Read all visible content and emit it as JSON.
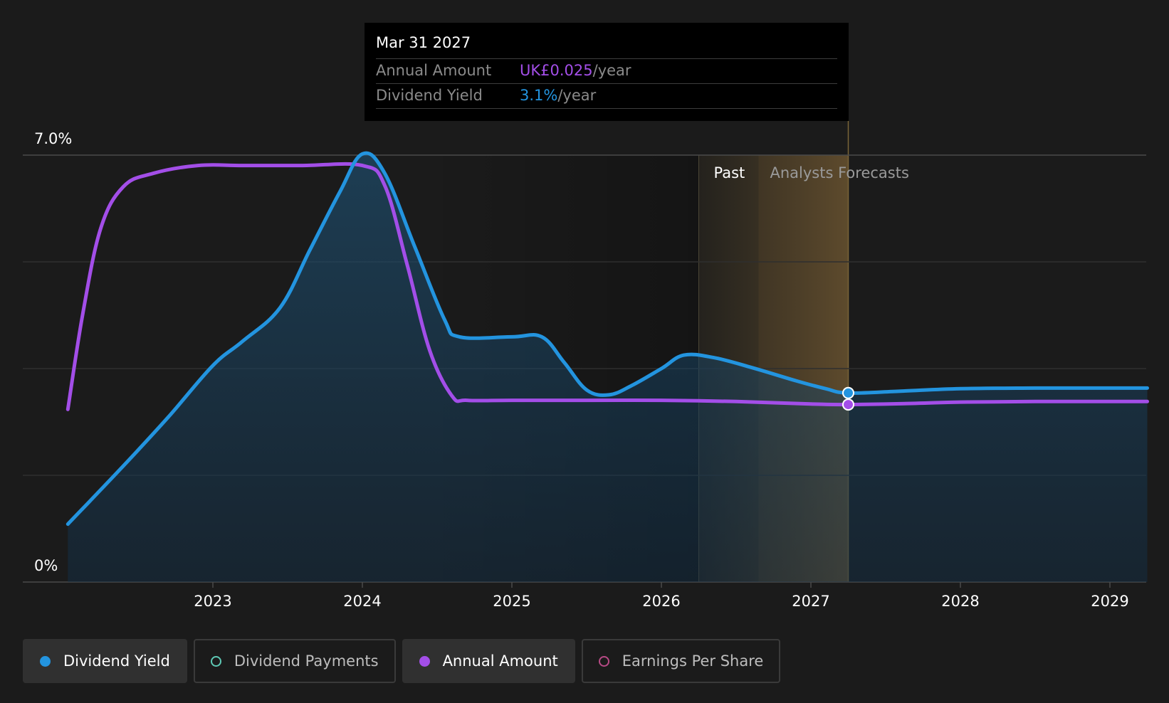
{
  "chart_data": {
    "type": "line",
    "y_axis": {
      "top_label": "7.0%",
      "bottom_label": "0%",
      "ylim": [
        0,
        7.0
      ],
      "unit": "%"
    },
    "x_axis": {
      "ticks": [
        "2023",
        "2024",
        "2025",
        "2026",
        "2027",
        "2028",
        "2029"
      ],
      "xlim": [
        2022.03,
        2029.25
      ]
    },
    "regions": {
      "past_label": "Past",
      "forecast_label": "Analysts Forecasts",
      "past_start": 2026.25,
      "past_end": 2026.65,
      "forecast_end": 2027.25
    },
    "series": [
      {
        "name": "Dividend Yield",
        "color": "#2394df",
        "filled": true,
        "points": [
          [
            2022.03,
            0.95
          ],
          [
            2022.4,
            1.9
          ],
          [
            2022.7,
            2.7
          ],
          [
            2023.0,
            3.55
          ],
          [
            2023.2,
            3.95
          ],
          [
            2023.45,
            4.5
          ],
          [
            2023.65,
            5.45
          ],
          [
            2023.85,
            6.4
          ],
          [
            2024.0,
            7.02
          ],
          [
            2024.15,
            6.7
          ],
          [
            2024.35,
            5.5
          ],
          [
            2024.55,
            4.3
          ],
          [
            2024.65,
            4.02
          ],
          [
            2025.0,
            4.02
          ],
          [
            2025.2,
            4.02
          ],
          [
            2025.35,
            3.6
          ],
          [
            2025.5,
            3.15
          ],
          [
            2025.65,
            3.07
          ],
          [
            2025.8,
            3.22
          ],
          [
            2026.0,
            3.5
          ],
          [
            2026.15,
            3.72
          ],
          [
            2026.35,
            3.68
          ],
          [
            2026.6,
            3.52
          ],
          [
            2026.9,
            3.3
          ],
          [
            2027.1,
            3.17
          ],
          [
            2027.25,
            3.1
          ],
          [
            2027.6,
            3.13
          ],
          [
            2028.0,
            3.17
          ],
          [
            2028.5,
            3.18
          ],
          [
            2029.25,
            3.18
          ]
        ],
        "marker": [
          2027.25,
          3.1
        ]
      },
      {
        "name": "Annual Amount",
        "color": "#a34ee8",
        "filled": false,
        "points": [
          [
            2022.03,
            2.83
          ],
          [
            2022.13,
            4.4
          ],
          [
            2022.25,
            5.8
          ],
          [
            2022.4,
            6.48
          ],
          [
            2022.6,
            6.7
          ],
          [
            2022.9,
            6.83
          ],
          [
            2023.2,
            6.83
          ],
          [
            2023.6,
            6.83
          ],
          [
            2024.0,
            6.83
          ],
          [
            2024.15,
            6.5
          ],
          [
            2024.3,
            5.2
          ],
          [
            2024.45,
            3.8
          ],
          [
            2024.6,
            3.05
          ],
          [
            2024.7,
            2.98
          ],
          [
            2025.0,
            2.98
          ],
          [
            2025.5,
            2.98
          ],
          [
            2026.0,
            2.98
          ],
          [
            2026.5,
            2.96
          ],
          [
            2027.0,
            2.92
          ],
          [
            2027.25,
            2.91
          ],
          [
            2027.7,
            2.93
          ],
          [
            2028.0,
            2.95
          ],
          [
            2028.5,
            2.96
          ],
          [
            2029.25,
            2.96
          ]
        ],
        "marker": [
          2027.25,
          2.91
        ]
      }
    ],
    "grid": true,
    "legend_position": "bottom-left"
  },
  "tooltip": {
    "date": "Mar 31 2027",
    "rows": [
      {
        "label": "Annual Amount",
        "value": "UK£0.025",
        "unit": "/year",
        "color": "#a34ee8"
      },
      {
        "label": "Dividend Yield",
        "value": "3.1%",
        "unit": "/year",
        "color": "#2394df"
      }
    ]
  },
  "legend": [
    {
      "label": "Dividend Yield",
      "color": "#2394df",
      "style": "filled",
      "active": true
    },
    {
      "label": "Dividend Payments",
      "color": "#5ec9b5",
      "style": "hollow",
      "active": false
    },
    {
      "label": "Annual Amount",
      "color": "#a34ee8",
      "style": "filled",
      "active": true
    },
    {
      "label": "Earnings Per Share",
      "color": "#b84a86",
      "style": "hollow",
      "active": false
    }
  ]
}
